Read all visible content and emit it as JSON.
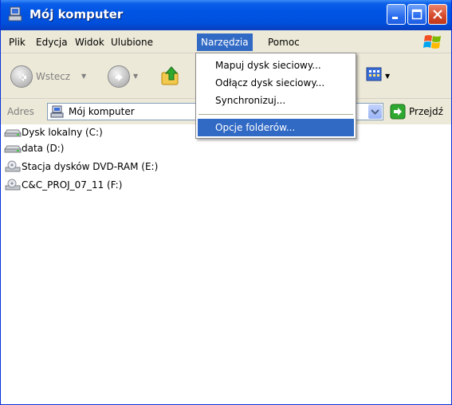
{
  "window": {
    "title": "Mój komputer"
  },
  "menubar": {
    "items": [
      {
        "label": "Plik"
      },
      {
        "label": "Edycja"
      },
      {
        "label": "Widok"
      },
      {
        "label": "Ulubione"
      },
      {
        "label": "Narzędzia"
      },
      {
        "label": "Pomoc"
      }
    ],
    "active": "Narzędzia"
  },
  "toolbar": {
    "back_label": "Wstecz"
  },
  "address": {
    "label": "Adres",
    "value": "Mój komputer",
    "go_label": "Przejdź"
  },
  "dropdown": {
    "items": [
      {
        "label": "Mapuj dysk sieciowy..."
      },
      {
        "label": "Odłącz dysk sieciowy..."
      },
      {
        "label": "Synchronizuj..."
      },
      {
        "label": "Opcje folderów..."
      }
    ],
    "highlighted": "Opcje folderów..."
  },
  "drives": [
    {
      "label": "Dysk lokalny (C:)",
      "icon": "hard-drive-icon"
    },
    {
      "label": "data (D:)",
      "icon": "hard-drive-icon"
    },
    {
      "label": "Stacja dysków DVD-RAM (E:)",
      "icon": "dvd-drive-icon"
    },
    {
      "label": "C&C_PROJ_07_11 (F:)",
      "icon": "cd-drive-icon"
    }
  ],
  "colors": {
    "titlebar": "#0054e3",
    "menu_highlight": "#316ac5",
    "close_button": "#d5492a",
    "chrome": "#ece9d8"
  }
}
